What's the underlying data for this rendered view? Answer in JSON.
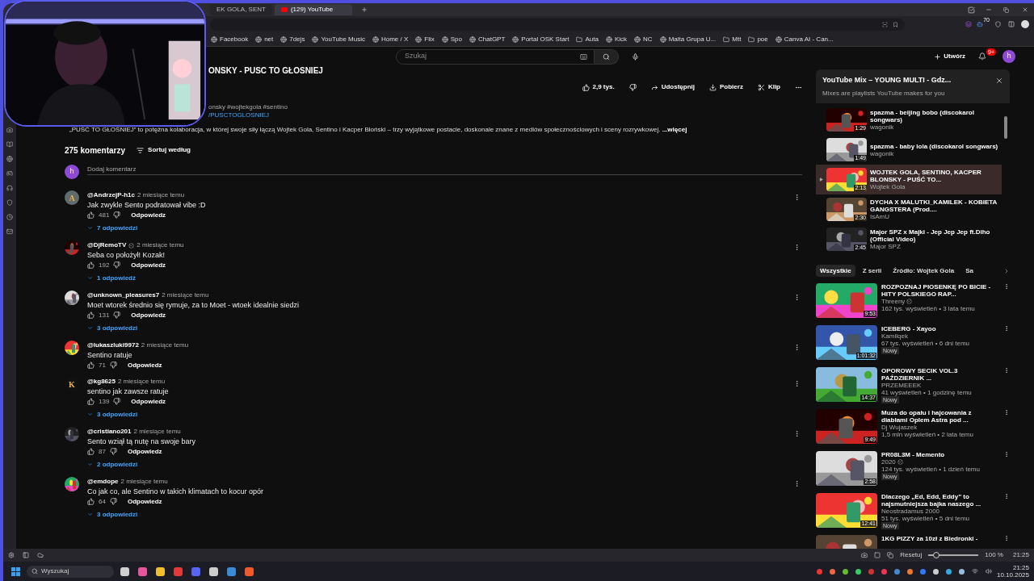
{
  "browser": {
    "tabs": [
      {
        "title": "EK GOLA, SENT",
        "selected": false
      },
      {
        "title": "(129) YouTube",
        "selected": true
      }
    ],
    "extension_badge": "70",
    "bookmarks": [
      {
        "label": "Facebook",
        "kind": "site"
      },
      {
        "label": "net",
        "kind": "site"
      },
      {
        "label": "7dejs",
        "kind": "site"
      },
      {
        "label": "YouTube Music",
        "kind": "site"
      },
      {
        "label": "Home / X",
        "kind": "site"
      },
      {
        "label": "Flix",
        "kind": "site"
      },
      {
        "label": "Spo",
        "kind": "site"
      },
      {
        "label": "ChatGPT",
        "kind": "site"
      },
      {
        "label": "Portal OSK Start",
        "kind": "site"
      },
      {
        "label": "Auta",
        "kind": "folder"
      },
      {
        "label": "Kick",
        "kind": "site"
      },
      {
        "label": "NC",
        "kind": "site"
      },
      {
        "label": "Malta Grupa U...",
        "kind": "site"
      },
      {
        "label": "Mtt",
        "kind": "folder"
      },
      {
        "label": "poe",
        "kind": "folder"
      },
      {
        "label": "Canva AI - Can...",
        "kind": "site"
      }
    ]
  },
  "masthead": {
    "search_placeholder": "Szukaj",
    "create": "Utwórz",
    "notifications": "9+",
    "avatar": "h"
  },
  "video": {
    "title": "ONSKY - PUSC TO GŁOSNIEJ",
    "likes": "2,9 tys.",
    "actions": [
      "Udostępnij",
      "Pobierz",
      "Klip"
    ],
    "hashtags": "onsky #wojtekgola #sentino",
    "link": "/PUSCTOGLOSNIEJ",
    "description": "„PUŚĆ TO GŁOŚNIEJ” to potężna kolaboracja, w której swoje siły łączą Wojtek Gola, Sentino i Kacper Błoński – trzy wyjątkowe postacie, doskonale znane z mediów społecznościowych i sceny rozrywkowej.",
    "more": "...więcej"
  },
  "comments": {
    "count": "275 komentarzy",
    "sort": "Sortuj według",
    "add_placeholder": "Dodaj komentarz",
    "user_avatar": "h",
    "items": [
      {
        "author": "@AndrzejP-h1c",
        "verified": false,
        "time": "2 miesiące temu",
        "text": "Jak zwykle Sento podratował vibe :D",
        "likes": "481",
        "reply": "Odpowiedz",
        "replies": "7 odpowiedzi",
        "avatar": {
          "kind": "letter",
          "letter": "A",
          "color": "#5f6b6d"
        }
      },
      {
        "author": "@DjRemoTV",
        "verified": true,
        "time": "2 miesiące temu",
        "text": "Seba co położył! Kozak!",
        "likes": "192",
        "reply": "Odpowiedz",
        "replies": "1 odpowiedź"
      },
      {
        "author": "@unknown_pleasures7",
        "verified": false,
        "time": "2 miesiące temu",
        "text": "Moet wtorek średnio się rymuje, za to Moet - wtoek idealnie siedzi",
        "likes": "131",
        "reply": "Odpowiedz",
        "replies": "3 odpowiedzi"
      },
      {
        "author": "@lukaszluki9972",
        "verified": false,
        "time": "2 miesiące temu",
        "text": "Sentino ratuje",
        "likes": "71",
        "reply": "Odpowiedz"
      },
      {
        "author": "@kg8625",
        "verified": false,
        "time": "2 miesiące temu",
        "text": "sentino jak zawsze ratuje",
        "likes": "139",
        "reply": "Odpowiedz",
        "replies": "3 odpowiedzi",
        "avatar": {
          "kind": "letter",
          "letter": "K",
          "color": "#111111"
        }
      },
      {
        "author": "@cristiano201",
        "verified": false,
        "time": "2 miesiące temu",
        "text": "Sento wziął tą nutę na swoje bary",
        "likes": "87",
        "reply": "Odpowiedz",
        "replies": "2 odpowiedzi"
      },
      {
        "author": "@emdope",
        "verified": false,
        "time": "2 miesiące temu",
        "text": "Co jak co, ale Sentino w takich klimatach to kocur opór",
        "likes": "64",
        "reply": "Odpowiedz",
        "replies": "3 odpowiedzi"
      }
    ]
  },
  "mix": {
    "title": "YouTube Mix – YOUNG MULTI - Gdz...",
    "subtitle": "Mixes are playlists YouTube makes for you",
    "items": [
      {
        "title": "spazma - beijing bobo (discokarol songwars)",
        "channel": "wagonik",
        "duration": "1:29",
        "selected": false
      },
      {
        "title": "spazma - baby lola (discokarol songwars)",
        "channel": "wagonik",
        "duration": "1:49",
        "selected": false
      },
      {
        "title": "WOJTEK GOLA, SENTINO, KACPER BLONSKY - PUŚĆ TO...",
        "channel": "Wojtek Gola",
        "duration": "2:13",
        "selected": true
      },
      {
        "title": "DYCHA X MALUTKI_KAMILEK - KOBIETA GANGSTERA (Prod....",
        "channel": "IsAmU",
        "duration": "2:30",
        "selected": false
      },
      {
        "title": "Major SPZ x Majki - Jep Jep Jep ft.Diho (Official Video)",
        "channel": "Major SPZ",
        "duration": "2:45",
        "selected": false
      }
    ]
  },
  "chips": [
    {
      "label": "Wszystkie",
      "selected": true
    },
    {
      "label": "Z serii",
      "selected": false
    },
    {
      "label": "Źródło: Wojtek Gola",
      "selected": false
    },
    {
      "label": "Sa",
      "selected": false
    }
  ],
  "recommendations": [
    {
      "title": "ROZPOZNAJ PIOSENKĘ PO BICIE  - HITY POLSKIEGO RAP...",
      "channel": "Threeny",
      "verified": true,
      "stats": "162 tys. wyświetleń • 3 lata temu",
      "duration": "9:53"
    },
    {
      "title": "ICEBERG - Xayoo",
      "channel": "Kamilqek",
      "verified": false,
      "stats": "67 tys. wyświetleń • 6 dni temu",
      "badge": "Nowy",
      "duration": "1:01:32"
    },
    {
      "title": "OPOROWY SECIK VOL.3 PAŹDZIERNIK ...",
      "channel": "PRZEMEEEK",
      "verified": false,
      "stats": "41 wyświetleń • 1 godzinę temu",
      "badge": "Nowy",
      "duration": "14:37"
    },
    {
      "title": "Muza do opału i hajcowania z diabłami Oplem Astra pod ...",
      "channel": "Dj Wujaszek",
      "verified": false,
      "stats": "1,5 mln wyświetleń • 2 lata temu",
      "duration": "9:49"
    },
    {
      "title": "PR08L3M - Memento",
      "channel": "2020",
      "verified": true,
      "stats": "124 tys. wyświetleń • 1 dzień temu",
      "badge": "Nowy",
      "duration": "2:58"
    },
    {
      "title": "Dlaczego „Ed, Edd, Eddy” to najsmutniejsza bajka naszego ...",
      "channel": "Neostradamus 2000",
      "verified": false,
      "stats": "51 tys. wyświetleń • 5 dni temu",
      "badge": "Nowy",
      "duration": "12:41"
    },
    {
      "title": "1KG PIZZY za 10zł z Biedronki -"
    }
  ],
  "status_bar": {
    "reset": "Resetuj",
    "zoom": {
      "level": 0.15
    },
    "zoom_label": "100 %",
    "time": "21:25"
  },
  "taskbar": {
    "search_placeholder": "Wyszukaj",
    "time": "21:25",
    "date": "10.10.2025"
  }
}
